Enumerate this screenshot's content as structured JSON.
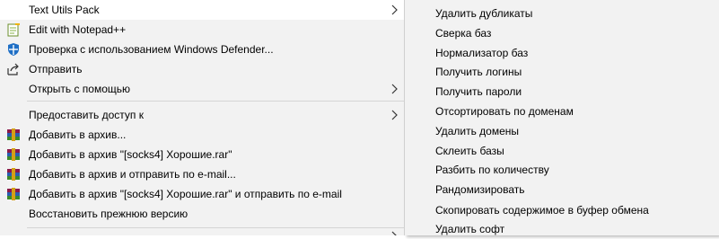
{
  "main_menu": {
    "items": [
      {
        "label": "Text Utils Pack",
        "icon": "blank-icon",
        "submenu": true
      },
      {
        "label": "Edit with Notepad++",
        "icon": "notepad-plus-plus-icon",
        "submenu": false
      },
      {
        "label": "Проверка с использованием Windows Defender...",
        "icon": "windows-defender-icon",
        "submenu": false
      },
      {
        "label": "Отправить",
        "icon": "share-icon",
        "submenu": false
      },
      {
        "label": "Открыть с помощью",
        "icon": "blank-icon",
        "submenu": true
      },
      {
        "label": "Предоставить доступ к",
        "icon": "blank-icon",
        "submenu": true
      },
      {
        "label": "Добавить в архив...",
        "icon": "winrar-icon",
        "submenu": false
      },
      {
        "label": "Добавить в архив \"[socks4] Хорошие.rar\"",
        "icon": "winrar-icon",
        "submenu": false
      },
      {
        "label": "Добавить в архив и отправить по e-mail...",
        "icon": "winrar-icon",
        "submenu": false
      },
      {
        "label": "Добавить в архив \"[socks4] Хорошие.rar\" и отправить по e-mail",
        "icon": "winrar-icon",
        "submenu": false
      },
      {
        "label": "Восстановить прежнюю версию",
        "icon": "blank-icon",
        "submenu": false
      }
    ]
  },
  "sub_menu": {
    "items": [
      "Удалить дубликаты",
      "Сверка баз",
      "Нормализатор баз",
      "Получить логины",
      "Получить пароли",
      "Отсортировать по доменам",
      "Удалить домены",
      "Склеить базы",
      "Разбить по количеству",
      "Рандомизировать",
      "Скопировать содержимое в буфер обмена",
      "Удалить софт"
    ]
  },
  "colors": {
    "menu_bg": "#f2f2f2",
    "highlight": "#ffffff",
    "separator": "#d5d5d5",
    "winrar": "#8b1a4a",
    "defender_blue": "#1f6fc5"
  }
}
